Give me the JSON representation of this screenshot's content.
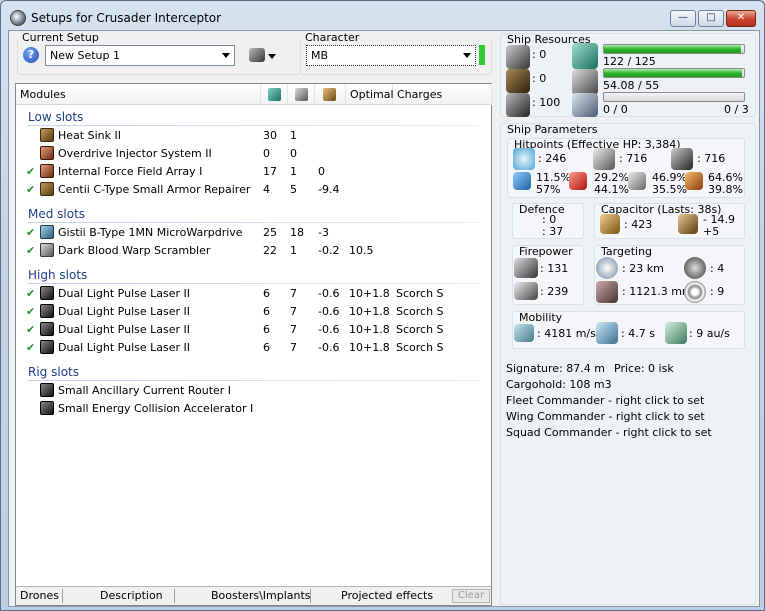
{
  "window": {
    "title": "Setups for Crusader Interceptor"
  },
  "setup": {
    "label": "Current Setup",
    "value": "New Setup 1"
  },
  "character": {
    "label": "Character",
    "value": "MB"
  },
  "modules": {
    "headers": {
      "name": "Modules",
      "optimal": "Optimal",
      "charges": "Charges"
    },
    "sections": [
      {
        "title": "Low slots",
        "items": [
          {
            "name": "Heat Sink II",
            "checked": false,
            "icon": "heat-sink-icon",
            "cpu": "30",
            "pg": "1",
            "cap": "",
            "optimal": "",
            "charges": ""
          },
          {
            "name": "Overdrive Injector System II",
            "checked": false,
            "icon": "overdrive-icon",
            "cpu": "0",
            "pg": "0",
            "cap": "",
            "optimal": "",
            "charges": ""
          },
          {
            "name": "Internal Force Field Array I",
            "checked": true,
            "icon": "force-field-icon",
            "cpu": "17",
            "pg": "1",
            "cap": "0",
            "optimal": "",
            "charges": ""
          },
          {
            "name": "Centii C-Type Small Armor Repairer",
            "checked": true,
            "icon": "armor-repairer-icon",
            "cpu": "4",
            "pg": "5",
            "cap": "-9.4",
            "optimal": "",
            "charges": ""
          }
        ]
      },
      {
        "title": "Med slots",
        "items": [
          {
            "name": "Gistii B-Type 1MN MicroWarpdrive",
            "checked": true,
            "icon": "microwarpdrive-icon",
            "cpu": "25",
            "pg": "18",
            "cap": "-3",
            "optimal": "",
            "charges": ""
          },
          {
            "name": "Dark Blood Warp Scrambler",
            "checked": true,
            "icon": "warp-scrambler-icon",
            "cpu": "22",
            "pg": "1",
            "cap": "-0.2",
            "optimal": "10.5",
            "charges": ""
          }
        ]
      },
      {
        "title": "High slots",
        "items": [
          {
            "name": "Dual Light Pulse Laser II",
            "checked": true,
            "icon": "laser-icon",
            "cpu": "6",
            "pg": "7",
            "cap": "-0.6",
            "optimal": "10+1.8",
            "charges": "Scorch S"
          },
          {
            "name": "Dual Light Pulse Laser II",
            "checked": true,
            "icon": "laser-icon",
            "cpu": "6",
            "pg": "7",
            "cap": "-0.6",
            "optimal": "10+1.8",
            "charges": "Scorch S"
          },
          {
            "name": "Dual Light Pulse Laser II",
            "checked": true,
            "icon": "laser-icon",
            "cpu": "6",
            "pg": "7",
            "cap": "-0.6",
            "optimal": "10+1.8",
            "charges": "Scorch S"
          },
          {
            "name": "Dual Light Pulse Laser II",
            "checked": true,
            "icon": "laser-icon",
            "cpu": "6",
            "pg": "7",
            "cap": "-0.6",
            "optimal": "10+1.8",
            "charges": "Scorch S"
          }
        ]
      },
      {
        "title": "Rig slots",
        "items": [
          {
            "name": "Small Ancillary Current Router I",
            "checked": false,
            "icon": "rig-router-icon",
            "cpu": "",
            "pg": "",
            "cap": "",
            "optimal": "",
            "charges": ""
          },
          {
            "name": "Small Energy Collision Accelerator I",
            "checked": false,
            "icon": "rig-accelerator-icon",
            "cpu": "",
            "pg": "",
            "cap": "",
            "optimal": "",
            "charges": ""
          }
        ]
      }
    ]
  },
  "bottom_tabs": [
    "Drones",
    "Description",
    "Boosters\\Implants",
    "Projected effects",
    "Clear"
  ],
  "resources": {
    "title": "Ship Resources",
    "hardpoints": [
      ": 0",
      ": 0",
      ": 100"
    ],
    "cpu": {
      "text": "122 / 125",
      "fraction": 0.976
    },
    "powergrid": {
      "text": "54.08 / 55",
      "fraction": 0.983
    },
    "calibration": {
      "text": "0 / 0",
      "rigs": "0 / 3",
      "fraction": 0
    }
  },
  "params": {
    "title": "Ship Parameters",
    "hitpoints": {
      "label": "Hitpoints (Effective HP: 3,384)",
      "shield": ": 246",
      "armor": ": 716",
      "hull": ": 716",
      "resists": [
        {
          "top": "11.5%",
          "bottom": "57%"
        },
        {
          "top": "29.2%",
          "bottom": "44.1%"
        },
        {
          "top": "46.9%",
          "bottom": "35.5%"
        },
        {
          "top": "64.6%",
          "bottom": "39.8%"
        }
      ]
    },
    "defence": {
      "label": "Defence",
      "a": ": 0",
      "b": ": 37"
    },
    "capacitor": {
      "label": "Capacitor (Lasts: 38s)",
      "amount": ": 423",
      "delta_top": "- 14.9",
      "delta_bottom": "+5"
    },
    "firepower": {
      "label": "Firepower",
      "turret": ": 131",
      "missile": ": 239"
    },
    "targeting": {
      "label": "Targeting",
      "range": ": 23 km",
      "targets": ": 4",
      "resolution": ": 1121.3 mm",
      "sensor": ": 9"
    },
    "mobility": {
      "label": "Mobility",
      "speed": ": 4181 m/s",
      "align": ": 4.7 s",
      "warp": ": 9 au/s"
    },
    "signature": "Signature: 87.4 m",
    "price": "Price: 0 isk",
    "cargohold": "Cargohold: 108 m3",
    "fleet": "Fleet Commander - right click to set",
    "wing": "Wing Commander - right click to set",
    "squad": "Squad Commander - right click to set"
  }
}
